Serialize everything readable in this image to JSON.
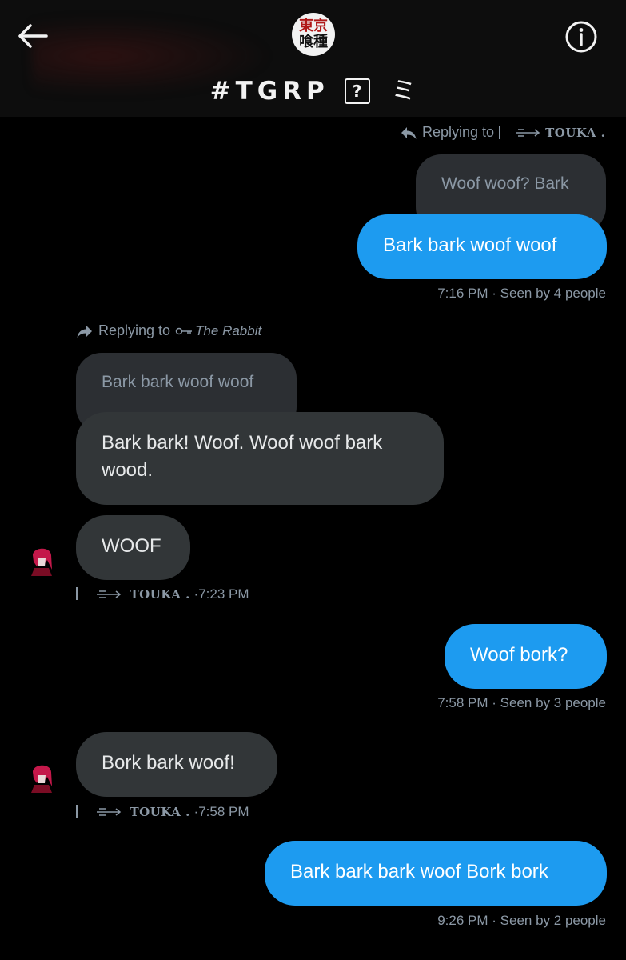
{
  "header": {
    "group_title": "#TGRP",
    "title_box_glyph": "?",
    "title_trailing_glyph": "ミ",
    "avatar_text_top": "東京",
    "avatar_text_bottom": "喰種"
  },
  "messages": [
    {
      "reply_prefix": "Replying to",
      "reply_target": "TOUKA .",
      "quoted_text": "Woof woof? Bark",
      "text": "Bark bark woof woof",
      "time": "7:16 PM",
      "seen": "Seen by 4 people"
    },
    {
      "reply_prefix": "Replying to",
      "reply_target": "The Rabbit",
      "quoted_text": "Bark bark woof woof",
      "text": "Bark bark! Woof. Woof woof bark wood."
    },
    {
      "text": "WOOF",
      "sender": "TOUKA .",
      "time": "7:23 PM"
    },
    {
      "text": "Woof bork?",
      "time": "7:58 PM",
      "seen": "Seen by 3 people"
    },
    {
      "text": "Bork bark woof!",
      "sender": "TOUKA .",
      "time": "7:58 PM"
    },
    {
      "text": "Bark bark bark woof Bork bork",
      "time": "9:26 PM",
      "seen": "Seen by 2 people"
    }
  ],
  "icons": {
    "back": "arrow-left-icon",
    "info": "info-circle-icon",
    "reply": "reply-arrow-icon",
    "key": "key-icon",
    "decoration": "arrow-decoration-icon"
  },
  "colors": {
    "background": "#000000",
    "sent_bubble": "#1d9bf0",
    "received_bubble": "#323638",
    "quoted_bubble": "#2c2f33",
    "meta_text": "#8b98a5"
  }
}
